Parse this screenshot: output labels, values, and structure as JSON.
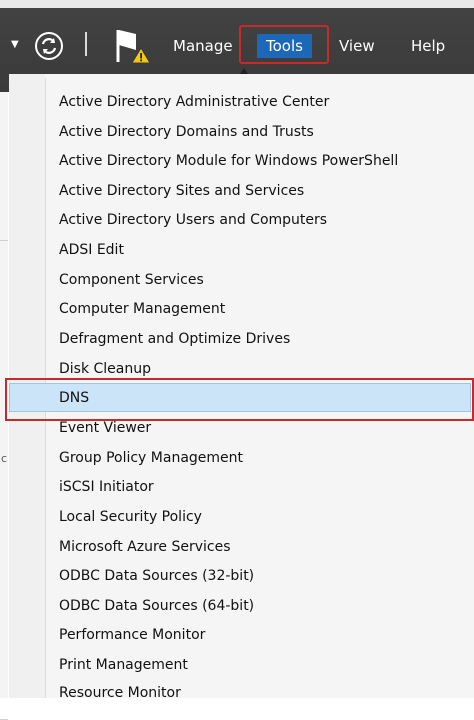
{
  "toolbar": {
    "menu": {
      "manage": "Manage",
      "tools": "Tools",
      "view": "View",
      "help": "Help"
    }
  },
  "tools_menu": {
    "selected": "DNS",
    "items": [
      "Active Directory Administrative Center",
      "Active Directory Domains and Trusts",
      "Active Directory Module for Windows PowerShell",
      "Active Directory Sites and Services",
      "Active Directory Users and Computers",
      "ADSI Edit",
      "Component Services",
      "Computer Management",
      "Defragment and Optimize Drives",
      "Disk Cleanup",
      "DNS",
      "Event Viewer",
      "Group Policy Management",
      "iSCSI Initiator",
      "Local Security Policy",
      "Microsoft Azure Services",
      "ODBC Data Sources (32-bit)",
      "ODBC Data Sources (64-bit)",
      "Performance Monitor",
      "Print Management",
      "Resource Monitor"
    ]
  },
  "background_window": {
    "fragment_char": "c"
  },
  "colors": {
    "toolbar_bg": "#3e3e3e",
    "tools_active": "#1c67b7",
    "highlight_border": "#c62a2a",
    "selection_bg": "#cce4f7"
  },
  "icons": [
    "dropdown-arrow-icon",
    "refresh-icon",
    "notification-flag-icon",
    "warning-icon"
  ]
}
